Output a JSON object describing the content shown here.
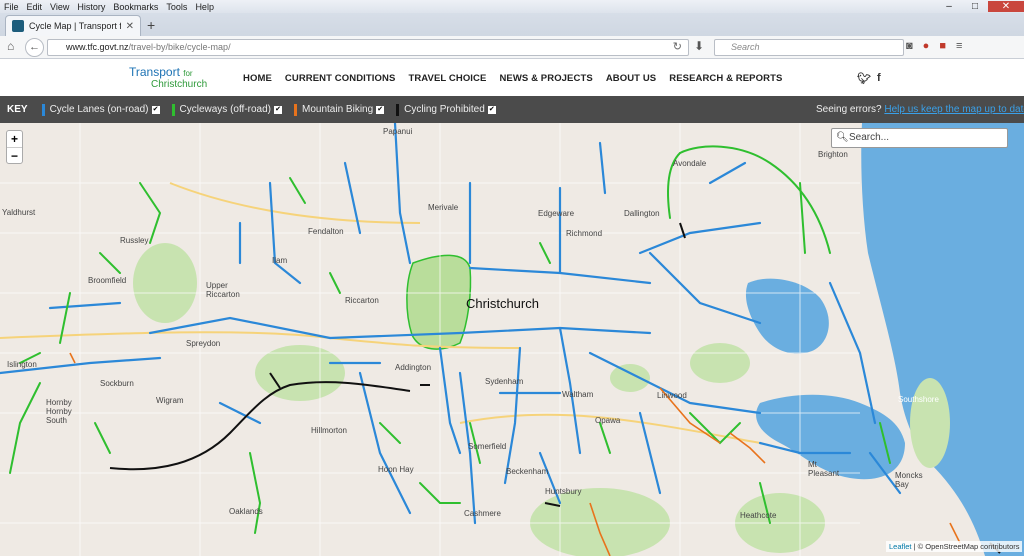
{
  "browser": {
    "menu": [
      "File",
      "Edit",
      "View",
      "History",
      "Bookmarks",
      "Tools",
      "Help"
    ],
    "tab_title": "Cycle Map | Transport for ...",
    "url_host": "www.tfc.govt.nz",
    "url_path": "/travel-by/bike/cycle-map/",
    "search_placeholder": "Search"
  },
  "site": {
    "logo_line1": "Transport",
    "logo_for": "for",
    "logo_line2": "Christchurch",
    "nav": [
      "HOME",
      "CURRENT CONDITIONS",
      "TRAVEL CHOICE",
      "NEWS & PROJECTS",
      "ABOUT US",
      "RESEARCH & REPORTS"
    ]
  },
  "key": {
    "label": "KEY",
    "items": [
      {
        "label": "Cycle Lanes (on-road)",
        "color": "#2b88d8"
      },
      {
        "label": "Cycleways (off-road)",
        "color": "#2fbf2f"
      },
      {
        "label": "Mountain Biking",
        "color": "#e8731c"
      },
      {
        "label": "Cycling Prohibited",
        "color": "#111111"
      }
    ],
    "errors_text": "Seeing errors?",
    "errors_link": "Help us keep the map up to date"
  },
  "map": {
    "search_placeholder": "Search...",
    "attribution_link": "Leaflet",
    "attribution_text": "| © OpenStreetMap contributors",
    "city_label": "Christchurch",
    "colors": {
      "land": "#efeae4",
      "water": "#6aaee0",
      "park": "#c8e3b0",
      "lane": "#2b88d8",
      "cycleway": "#2fbf2f",
      "mtb": "#e8731c",
      "prohibited": "#111111"
    },
    "places": [
      "Papanui",
      "Avondale",
      "Brighton",
      "Merivale",
      "Edgeware",
      "Dallington",
      "Fendalton",
      "Richmond",
      "Russley",
      "Ilam",
      "Upper Riccarton",
      "Riccarton",
      "Broomfield",
      "Spreydon",
      "Islington",
      "Hornby",
      "Hornby South",
      "Wigram",
      "Addington",
      "Sydenham",
      "Waltham",
      "Linwood",
      "Opawa",
      "Hillmorton",
      "Somerfield",
      "Beckenham",
      "Hoon Hay",
      "Huntsbury",
      "Cashmere",
      "Oaklands",
      "Southshore",
      "Mt Pleasant",
      "Moncks Bay",
      "Heathcote",
      "Yaldhurst",
      "Sockburn"
    ]
  }
}
